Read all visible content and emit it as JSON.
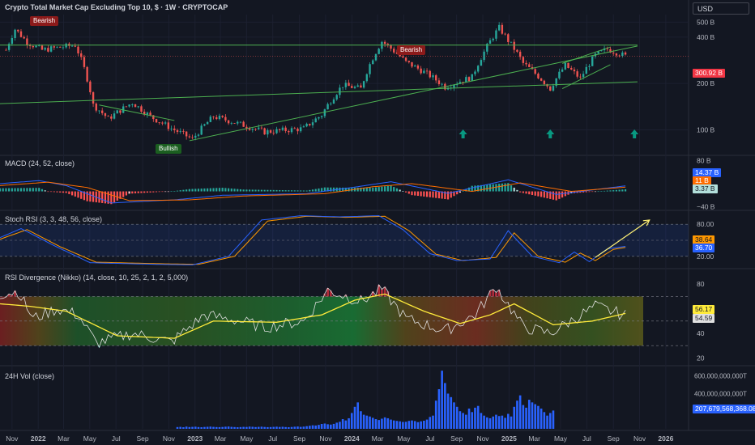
{
  "header": {
    "title": "Crypto Total Market Cap Excluding Top 10, $ · 1W · CRYPTOCAP",
    "currency": "USD"
  },
  "colors": {
    "background": "#131722",
    "up": "#26a69a",
    "down": "#ef5350",
    "trendline": "#4caf50",
    "macd_line": "#2962ff",
    "signal_line": "#ff6d00",
    "stoch_k": "#2962ff",
    "stoch_d": "#ff9800",
    "rsi_line": "#e0e0e0",
    "rsi_ma": "#ffeb3b",
    "volume": "#2962ff",
    "annotation_arrow": "#fff176"
  },
  "chart_data": [
    {
      "type": "candlestick",
      "pane": "price",
      "title": "Crypto Total Market Cap Excluding Top 10, $ · 1W · CRYPTOCAP",
      "y_scale": "log",
      "y_ticks": [
        "500 B",
        "400 B",
        "200 B",
        "100 B"
      ],
      "y_tick_values": [
        500,
        400,
        200,
        100
      ],
      "ylim": [
        70,
        560
      ],
      "last_value": 300.92,
      "last_value_label": "300.92 B",
      "key_points": [
        {
          "date": "2021-10-18",
          "value": 330
        },
        {
          "date": "2021-11-08",
          "value": 450
        },
        {
          "date": "2021-12-06",
          "value": 370
        },
        {
          "date": "2022-01-10",
          "value": 330
        },
        {
          "date": "2022-03-28",
          "value": 355
        },
        {
          "date": "2022-05-09",
          "value": 145
        },
        {
          "date": "2022-06-13",
          "value": 118
        },
        {
          "date": "2022-08-08",
          "value": 150
        },
        {
          "date": "2022-09-19",
          "value": 122
        },
        {
          "date": "2022-11-07",
          "value": 102
        },
        {
          "date": "2022-12-26",
          "value": 87
        },
        {
          "date": "2023-02-13",
          "value": 122
        },
        {
          "date": "2023-06-12",
          "value": 97
        },
        {
          "date": "2023-09-11",
          "value": 102
        },
        {
          "date": "2023-10-23",
          "value": 125
        },
        {
          "date": "2023-12-11",
          "value": 195
        },
        {
          "date": "2024-01-22",
          "value": 185
        },
        {
          "date": "2024-03-11",
          "value": 375
        },
        {
          "date": "2024-05-06",
          "value": 275
        },
        {
          "date": "2024-07-01",
          "value": 225
        },
        {
          "date": "2024-08-05",
          "value": 190
        },
        {
          "date": "2024-10-07",
          "value": 220
        },
        {
          "date": "2024-11-04",
          "value": 320
        },
        {
          "date": "2024-12-09",
          "value": 460
        },
        {
          "date": "2024-12-30",
          "value": 380
        },
        {
          "date": "2025-02-03",
          "value": 270
        },
        {
          "date": "2025-04-07",
          "value": 185
        },
        {
          "date": "2025-05-12",
          "value": 262
        },
        {
          "date": "2025-06-16",
          "value": 215
        },
        {
          "date": "2025-07-21",
          "value": 305
        },
        {
          "date": "2025-08-18",
          "value": 335
        },
        {
          "date": "2025-09-29",
          "value": 301
        }
      ],
      "annotations": [
        {
          "label": "Bearish",
          "date": "2021-11-15"
        },
        {
          "label": "Bearish",
          "date": "2024-03-11"
        },
        {
          "label": "Bullish",
          "date": "2022-11-07"
        }
      ],
      "up_arrows": [
        "2024-09-16",
        "2025-04-07",
        "2025-10-20"
      ],
      "trendlines": [
        {
          "from": {
            "date": "2021-10-04",
            "value": 355
          },
          "to": {
            "date": "2025-10-27",
            "value": 355
          }
        },
        {
          "from": {
            "date": "2021-10-04",
            "value": 148
          },
          "to": {
            "date": "2025-10-27",
            "value": 205
          }
        },
        {
          "from": {
            "date": "2022-12-19",
            "value": 85
          },
          "to": {
            "date": "2025-10-27",
            "value": 350
          }
        },
        {
          "from": {
            "date": "2025-05-05",
            "value": 270
          },
          "to": {
            "date": "2025-08-25",
            "value": 345
          }
        },
        {
          "from": {
            "date": "2025-05-05",
            "value": 185
          },
          "to": {
            "date": "2025-08-25",
            "value": 265
          }
        },
        {
          "from": {
            "date": "2022-05-23",
            "value": 145
          },
          "to": {
            "date": "2022-11-14",
            "value": 115
          }
        }
      ]
    },
    {
      "type": "line",
      "pane": "macd",
      "title": "MACD (24, 52, close)",
      "y_ticks": [
        "80 B",
        "−40 B"
      ],
      "y_tick_values": [
        80,
        -40
      ],
      "ylim": [
        -45,
        85
      ],
      "last_values": {
        "histogram": 3.37,
        "macd": 14.37,
        "signal": 11.0
      },
      "last_labels": {
        "macd": "14.37 B",
        "signal": "11 B",
        "histogram": "3.37 B"
      },
      "macd_points": [
        {
          "date": "2021-10-04",
          "value": 20
        },
        {
          "date": "2022-01-03",
          "value": 28
        },
        {
          "date": "2022-03-07",
          "value": 15
        },
        {
          "date": "2022-06-20",
          "value": -30
        },
        {
          "date": "2022-11-14",
          "value": -22
        },
        {
          "date": "2023-03-06",
          "value": -10
        },
        {
          "date": "2023-09-18",
          "value": -6
        },
        {
          "date": "2024-01-01",
          "value": 10
        },
        {
          "date": "2024-04-01",
          "value": 25
        },
        {
          "date": "2024-08-12",
          "value": -5
        },
        {
          "date": "2024-12-30",
          "value": 30
        },
        {
          "date": "2025-04-21",
          "value": -8
        },
        {
          "date": "2025-09-29",
          "value": 14.37
        }
      ],
      "signal_points": [
        {
          "date": "2021-10-04",
          "value": 15
        },
        {
          "date": "2022-01-24",
          "value": 24
        },
        {
          "date": "2022-04-25",
          "value": 10
        },
        {
          "date": "2022-08-01",
          "value": -24
        },
        {
          "date": "2022-12-19",
          "value": -22
        },
        {
          "date": "2023-04-24",
          "value": -12
        },
        {
          "date": "2023-10-30",
          "value": -6
        },
        {
          "date": "2024-02-19",
          "value": 12
        },
        {
          "date": "2024-05-20",
          "value": 20
        },
        {
          "date": "2024-10-07",
          "value": 0
        },
        {
          "date": "2025-01-27",
          "value": 22
        },
        {
          "date": "2025-05-26",
          "value": 0
        },
        {
          "date": "2025-09-29",
          "value": 11.0
        }
      ]
    },
    {
      "type": "line",
      "pane": "stoch_rsi",
      "title": "Stoch RSI (3, 3, 48, 56, close)",
      "y_ticks": [
        "80.00",
        "20.00"
      ],
      "y_tick_values": [
        80,
        20
      ],
      "ylim": [
        0,
        100
      ],
      "last_values": {
        "k": 38.64,
        "d": 36.7
      },
      "last_labels": {
        "k": "38.64",
        "d": "36.70"
      },
      "k_points": [
        {
          "date": "2021-10-04",
          "value": 55
        },
        {
          "date": "2021-11-22",
          "value": 72
        },
        {
          "date": "2022-02-07",
          "value": 40
        },
        {
          "date": "2022-05-02",
          "value": 8
        },
        {
          "date": "2022-10-03",
          "value": 5
        },
        {
          "date": "2022-12-26",
          "value": 4
        },
        {
          "date": "2023-03-20",
          "value": 20
        },
        {
          "date": "2023-06-05",
          "value": 88
        },
        {
          "date": "2023-09-04",
          "value": 96
        },
        {
          "date": "2023-12-04",
          "value": 94
        },
        {
          "date": "2024-03-04",
          "value": 96
        },
        {
          "date": "2024-04-29",
          "value": 70
        },
        {
          "date": "2024-07-01",
          "value": 25
        },
        {
          "date": "2024-09-02",
          "value": 12
        },
        {
          "date": "2024-11-18",
          "value": 15
        },
        {
          "date": "2024-12-30",
          "value": 68
        },
        {
          "date": "2025-02-24",
          "value": 20
        },
        {
          "date": "2025-04-28",
          "value": 8
        },
        {
          "date": "2025-06-02",
          "value": 28
        },
        {
          "date": "2025-07-07",
          "value": 10
        },
        {
          "date": "2025-08-18",
          "value": 34
        },
        {
          "date": "2025-09-29",
          "value": 38.64
        }
      ],
      "d_points": [
        {
          "date": "2021-10-04",
          "value": 52
        },
        {
          "date": "2021-12-06",
          "value": 70
        },
        {
          "date": "2022-02-21",
          "value": 38
        },
        {
          "date": "2022-05-16",
          "value": 9
        },
        {
          "date": "2022-10-17",
          "value": 6
        },
        {
          "date": "2023-01-09",
          "value": 5
        },
        {
          "date": "2023-04-03",
          "value": 20
        },
        {
          "date": "2023-06-19",
          "value": 86
        },
        {
          "date": "2023-09-18",
          "value": 95
        },
        {
          "date": "2023-12-18",
          "value": 93
        },
        {
          "date": "2024-03-18",
          "value": 95
        },
        {
          "date": "2024-05-13",
          "value": 68
        },
        {
          "date": "2024-07-15",
          "value": 24
        },
        {
          "date": "2024-09-16",
          "value": 12
        },
        {
          "date": "2024-12-02",
          "value": 18
        },
        {
          "date": "2025-01-13",
          "value": 64
        },
        {
          "date": "2025-03-10",
          "value": 20
        },
        {
          "date": "2025-05-12",
          "value": 9
        },
        {
          "date": "2025-06-16",
          "value": 26
        },
        {
          "date": "2025-07-21",
          "value": 12
        },
        {
          "date": "2025-09-01",
          "value": 33
        },
        {
          "date": "2025-09-29",
          "value": 36.7
        }
      ],
      "arrow": {
        "from": {
          "date": "2025-07-21",
          "value": 18
        },
        "to": {
          "date": "2025-11-24",
          "value": 88
        }
      }
    },
    {
      "type": "line",
      "pane": "rsi_divergence",
      "title": "RSI Divergence (Nikko) (14, close, 10, 25, 2, 1, 2, 5,000)",
      "y_ticks": [
        "80",
        "60",
        "40",
        "20"
      ],
      "y_tick_values": [
        80,
        60,
        40,
        20
      ],
      "ylim": [
        15,
        90
      ],
      "overbought": 70,
      "oversold": 30,
      "last_values": {
        "ma": 56.17,
        "rsi": 54.59
      },
      "last_labels": {
        "ma": "56.17",
        "rsi": "54.59"
      },
      "rsi_points": [
        {
          "date": "2021-10-04",
          "value": 72
        },
        {
          "date": "2021-11-15",
          "value": 74
        },
        {
          "date": "2021-12-20",
          "value": 52
        },
        {
          "date": "2022-02-14",
          "value": 60
        },
        {
          "date": "2022-04-04",
          "value": 55
        },
        {
          "date": "2022-05-16",
          "value": 32
        },
        {
          "date": "2022-08-08",
          "value": 40
        },
        {
          "date": "2022-11-07",
          "value": 33
        },
        {
          "date": "2023-01-23",
          "value": 55
        },
        {
          "date": "2023-04-17",
          "value": 50
        },
        {
          "date": "2023-06-12",
          "value": 45
        },
        {
          "date": "2023-09-11",
          "value": 50
        },
        {
          "date": "2023-11-06",
          "value": 75
        },
        {
          "date": "2024-01-22",
          "value": 66
        },
        {
          "date": "2024-03-11",
          "value": 76
        },
        {
          "date": "2024-05-06",
          "value": 52
        },
        {
          "date": "2024-08-05",
          "value": 42
        },
        {
          "date": "2024-10-14",
          "value": 55
        },
        {
          "date": "2024-12-02",
          "value": 78
        },
        {
          "date": "2025-02-03",
          "value": 45
        },
        {
          "date": "2025-04-07",
          "value": 40
        },
        {
          "date": "2025-07-21",
          "value": 62
        },
        {
          "date": "2025-09-29",
          "value": 54.59
        }
      ],
      "ma_points": [
        {
          "date": "2021-10-04",
          "value": 64
        },
        {
          "date": "2021-12-13",
          "value": 62
        },
        {
          "date": "2022-03-07",
          "value": 58
        },
        {
          "date": "2022-07-04",
          "value": 38
        },
        {
          "date": "2022-11-14",
          "value": 36
        },
        {
          "date": "2023-02-13",
          "value": 50
        },
        {
          "date": "2023-07-10",
          "value": 49
        },
        {
          "date": "2023-10-23",
          "value": 55
        },
        {
          "date": "2024-01-08",
          "value": 67
        },
        {
          "date": "2024-03-18",
          "value": 72
        },
        {
          "date": "2024-06-17",
          "value": 58
        },
        {
          "date": "2024-09-09",
          "value": 48
        },
        {
          "date": "2024-11-18",
          "value": 55
        },
        {
          "date": "2025-01-13",
          "value": 64
        },
        {
          "date": "2025-04-14",
          "value": 47
        },
        {
          "date": "2025-07-14",
          "value": 50
        },
        {
          "date": "2025-09-29",
          "value": 56.17
        }
      ]
    },
    {
      "type": "bar",
      "pane": "volume",
      "title": "24H Vol (close)",
      "y_ticks": [
        "600,000,000,000T",
        "400,000,000,000T"
      ],
      "y_tick_values": [
        600,
        400
      ],
      "unit": "billion T",
      "ylim": [
        0,
        680
      ],
      "last_value": 207.68,
      "last_label": "207,679,568,368.08T",
      "start_date": "2022-11-21",
      "bars": [
        20,
        22,
        18,
        25,
        20,
        22,
        24,
        20,
        18,
        21,
        23,
        25,
        22,
        20,
        19,
        21,
        24,
        26,
        22,
        20,
        18,
        20,
        22,
        21,
        25,
        23,
        20,
        22,
        24,
        21,
        19,
        20,
        22,
        24,
        21,
        23,
        20,
        18,
        21,
        24,
        26,
        22,
        25,
        30,
        35,
        40,
        38,
        45,
        55,
        60,
        52,
        48,
        56,
        70,
        80,
        110,
        95,
        120,
        180,
        250,
        300,
        200,
        160,
        150,
        140,
        125,
        110,
        100,
        115,
        130,
        120,
        105,
        95,
        90,
        85,
        78,
        80,
        90,
        95,
        88,
        76,
        85,
        92,
        105,
        135,
        150,
        320,
        450,
        660,
        520,
        400,
        360,
        300,
        250,
        200,
        180,
        160,
        230,
        190,
        240,
        260,
        180,
        150,
        130,
        120,
        140,
        160,
        145,
        150,
        125,
        170,
        140,
        250,
        320,
        380,
        270,
        240,
        330,
        300,
        280,
        260,
        230,
        190,
        150,
        180,
        207.68
      ]
    }
  ],
  "x_axis": {
    "ticks": [
      {
        "label": "Nov",
        "date": "2021-11-01"
      },
      {
        "label": "2022",
        "date": "2022-01-01"
      },
      {
        "label": "Mar",
        "date": "2022-03-01"
      },
      {
        "label": "May",
        "date": "2022-05-01"
      },
      {
        "label": "Jul",
        "date": "2022-07-01"
      },
      {
        "label": "Sep",
        "date": "2022-09-01"
      },
      {
        "label": "Nov",
        "date": "2022-11-01"
      },
      {
        "label": "2023",
        "date": "2023-01-01"
      },
      {
        "label": "Mar",
        "date": "2023-03-01"
      },
      {
        "label": "May",
        "date": "2023-05-01"
      },
      {
        "label": "Jul",
        "date": "2023-07-01"
      },
      {
        "label": "Sep",
        "date": "2023-09-01"
      },
      {
        "label": "Nov",
        "date": "2023-11-01"
      },
      {
        "label": "2024",
        "date": "2024-01-01"
      },
      {
        "label": "Mar",
        "date": "2024-03-01"
      },
      {
        "label": "May",
        "date": "2024-05-01"
      },
      {
        "label": "Jul",
        "date": "2024-07-01"
      },
      {
        "label": "Sep",
        "date": "2024-09-01"
      },
      {
        "label": "Nov",
        "date": "2024-11-01"
      },
      {
        "label": "2025",
        "date": "2025-01-01"
      },
      {
        "label": "Mar",
        "date": "2025-03-01"
      },
      {
        "label": "May",
        "date": "2025-05-01"
      },
      {
        "label": "Jul",
        "date": "2025-07-01"
      },
      {
        "label": "Sep",
        "date": "2025-09-01"
      },
      {
        "label": "Nov",
        "date": "2025-11-01"
      },
      {
        "label": "2026",
        "date": "2026-01-01"
      }
    ],
    "range": [
      "2021-10-04",
      "2026-02-23"
    ]
  }
}
